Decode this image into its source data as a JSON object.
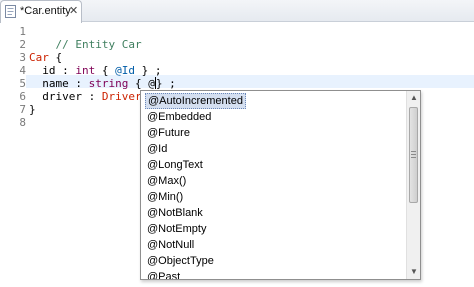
{
  "tab": {
    "label": "*Car.entity",
    "icon": "entity-file-icon",
    "close_glyph": "✕"
  },
  "editor": {
    "line_numbers": [
      "1",
      "2",
      "3",
      "4",
      "5",
      "6",
      "7",
      "8"
    ],
    "lines": {
      "l1_comment": "// Entity Car",
      "l3_keyword": "Car",
      "l3_rest": " {",
      "l4_prefix": "  id : ",
      "l4_type": "int",
      "l4_mid": " { ",
      "l4_anno": "@Id",
      "l4_rest": " } ;",
      "l5_prefix": "  name : ",
      "l5_type": "string",
      "l5_mid": " { @",
      "l5_rest": "} ;",
      "l6_prefix": "  driver : ",
      "l6_type": "Driver",
      "l6_rest": " ;",
      "l7": "}"
    },
    "current_line": "5"
  },
  "content_assist": {
    "selected_index": 0,
    "items": [
      "@AutoIncremented",
      "@Embedded",
      "@Future",
      "@Id",
      "@LongText",
      "@Max()",
      "@Min()",
      "@NotBlank",
      "@NotEmpty",
      "@NotNull",
      "@ObjectType",
      "@Past"
    ],
    "scroll_up_glyph": "▲",
    "scroll_down_glyph": "▼"
  },
  "colors": {
    "comment": "#3f7f5f",
    "keyword": "#7f0055",
    "annotation": "#005da8",
    "selection": "#d4dff0"
  }
}
